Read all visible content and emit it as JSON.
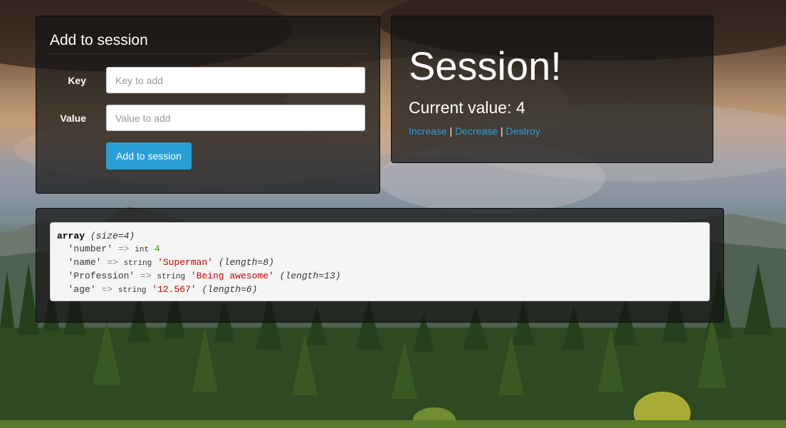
{
  "form": {
    "title": "Add to session",
    "key_label": "Key",
    "key_placeholder": "Key to add",
    "key_value": "",
    "value_label": "Value",
    "value_placeholder": "Value to add",
    "value_value": "",
    "submit_label": "Add to session"
  },
  "session": {
    "title": "Session!",
    "current_value": "Current value: 4",
    "links": {
      "increase": "Increase",
      "separator": "|",
      "decrease": "Decrease",
      "destroy": "Destroy"
    }
  },
  "dump": {
    "header": "array",
    "size": "(size=4)",
    "arrow": "=>",
    "rows": [
      {
        "key": "'number'",
        "type": "int",
        "value": "4",
        "meta": ""
      },
      {
        "key": "'name'",
        "type": "string",
        "value": "'Superman'",
        "meta": "(length=8)"
      },
      {
        "key": "'Profession'",
        "type": "string",
        "value": "'Being awesome'",
        "meta": "(length=13)"
      },
      {
        "key": "'age'",
        "type": "string",
        "value": "'12.567'",
        "meta": "(length=6)"
      }
    ]
  },
  "colors": {
    "accent": "#2a9fd6",
    "int_value": "#4e9a06",
    "string_value": "#cc0000"
  }
}
